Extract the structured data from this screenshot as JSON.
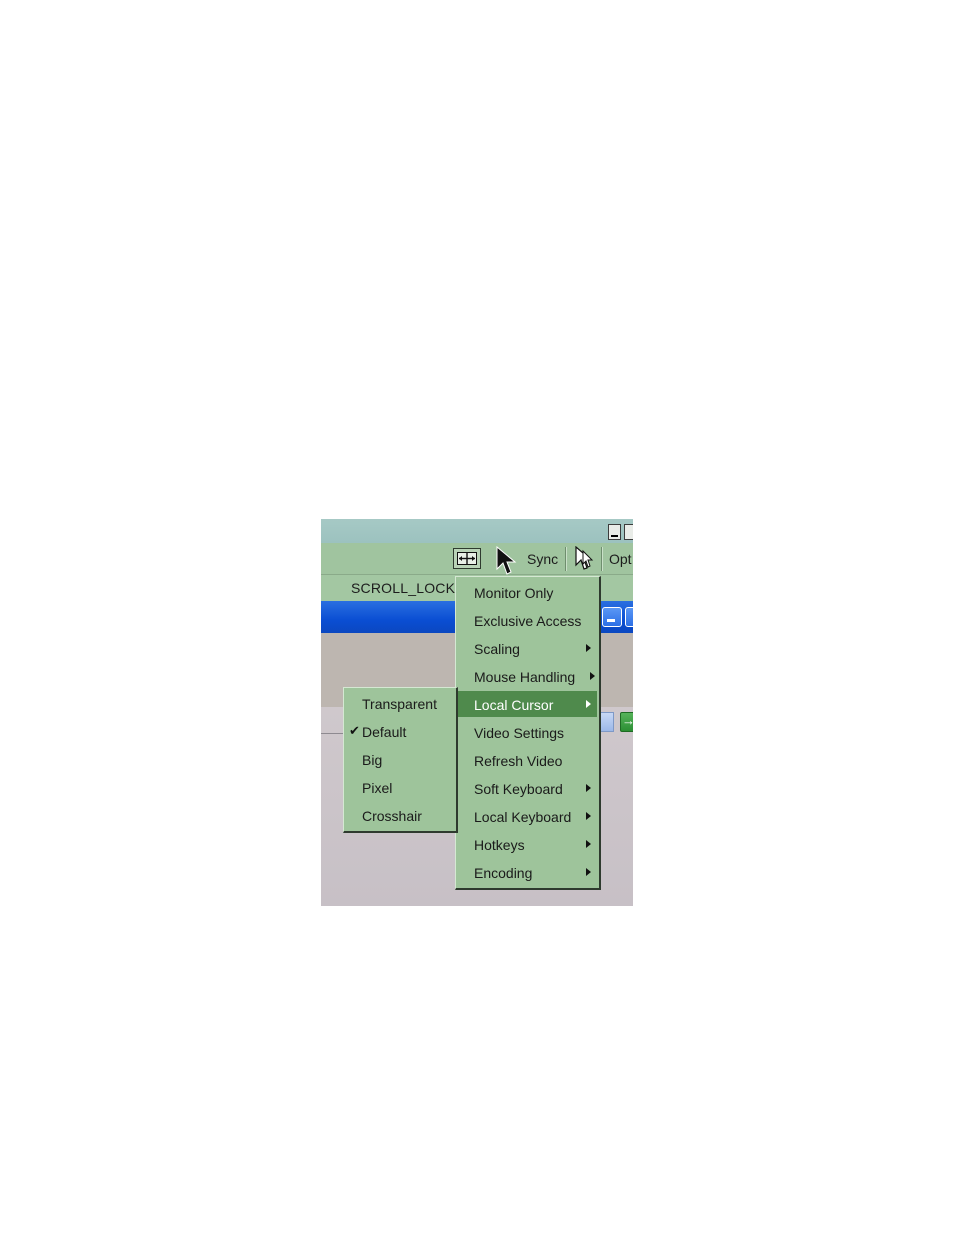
{
  "toolbar": {
    "sync_label": "Sync",
    "options_label": "Opt",
    "icons": [
      "fit-window-icon",
      "mouse-cursor-icon",
      "single-cursor-icon"
    ]
  },
  "statusbar": {
    "scroll_lock": "SCROLL_LOCK"
  },
  "main_menu": {
    "items": [
      {
        "label": "Monitor Only",
        "submenu": false
      },
      {
        "label": "Exclusive Access",
        "submenu": false
      },
      {
        "label": "Scaling",
        "submenu": true
      },
      {
        "label": "Mouse Handling",
        "submenu": true
      },
      {
        "label": "Local Cursor",
        "submenu": true,
        "highlighted": true
      },
      {
        "label": "Video Settings",
        "submenu": false
      },
      {
        "label": "Refresh Video",
        "submenu": false
      },
      {
        "label": "Soft Keyboard",
        "submenu": true
      },
      {
        "label": "Local Keyboard",
        "submenu": true
      },
      {
        "label": "Hotkeys",
        "submenu": true
      },
      {
        "label": "Encoding",
        "submenu": true
      }
    ]
  },
  "cursor_submenu": {
    "items": [
      {
        "label": "Transparent",
        "checked": false
      },
      {
        "label": "Default",
        "checked": true
      },
      {
        "label": "Big",
        "checked": false
      },
      {
        "label": "Pixel",
        "checked": false
      },
      {
        "label": "Crosshair",
        "checked": false
      }
    ]
  },
  "colors": {
    "menu_bg": "#9ec49b",
    "menu_highlight": "#4f8a4c",
    "toolbar_bg": "#a0c49f",
    "remote_titlebar": "#0a4ed3"
  }
}
